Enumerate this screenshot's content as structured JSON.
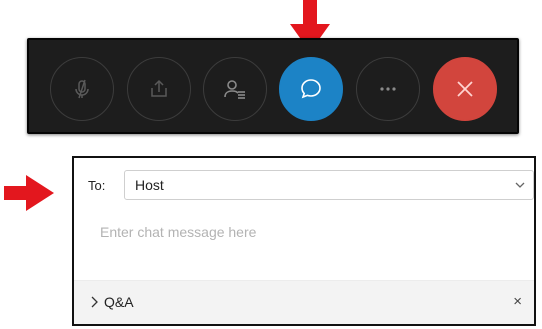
{
  "colors": {
    "toolbar_bg": "#1d1d1d",
    "chat_button": "#1c83c6",
    "end_button": "#d2453d",
    "callout_arrow": "#e3171e"
  },
  "toolbar": {
    "buttons": [
      {
        "name": "mute",
        "icon": "microphone-muted-icon",
        "active": false
      },
      {
        "name": "share",
        "icon": "share-screen-icon",
        "active": false
      },
      {
        "name": "participants",
        "icon": "participants-icon",
        "active": false
      },
      {
        "name": "chat",
        "icon": "chat-bubble-icon",
        "active": true
      },
      {
        "name": "more",
        "icon": "more-icon",
        "active": false
      },
      {
        "name": "end",
        "icon": "close-icon",
        "active": false
      }
    ]
  },
  "chat_panel": {
    "to_label": "To:",
    "to_value": "Host",
    "message_placeholder": "Enter chat message here",
    "qa_label": "Q&A",
    "qa_close": "×"
  }
}
